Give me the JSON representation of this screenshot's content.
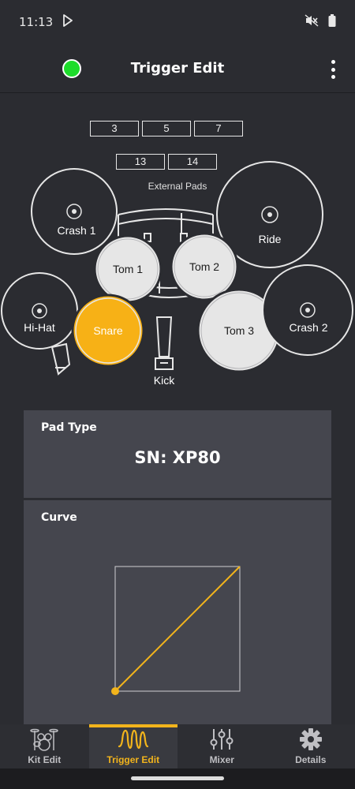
{
  "status_bar": {
    "time": "11:13"
  },
  "app_bar": {
    "title": "Trigger Edit",
    "connection_color": "#1ddc2b"
  },
  "kit": {
    "external_pad_buttons": [
      "3",
      "5",
      "7",
      "13",
      "14"
    ],
    "external_pads_label": "External Pads",
    "pads": {
      "crash1": "Crash 1",
      "ride": "Ride",
      "tom1": "Tom 1",
      "tom2": "Tom 2",
      "hihat": "Hi-Hat",
      "snare": "Snare",
      "tom3": "Tom 3",
      "crash2": "Crash 2",
      "kick": "Kick"
    },
    "selected_pad": "snare",
    "selected_color": "#f7b116"
  },
  "pad_type": {
    "title": "Pad Type",
    "value": "SN: XP80"
  },
  "curve": {
    "title": "Curve",
    "line_color": "#f2b41c"
  },
  "bottom_nav": {
    "items": [
      {
        "label": "Kit Edit",
        "icon": "drum-kit-icon"
      },
      {
        "label": "Trigger Edit",
        "icon": "waveform-icon"
      },
      {
        "label": "Mixer",
        "icon": "mixer-sliders-icon"
      },
      {
        "label": "Details",
        "icon": "gear-icon"
      }
    ],
    "active_index": 1
  }
}
